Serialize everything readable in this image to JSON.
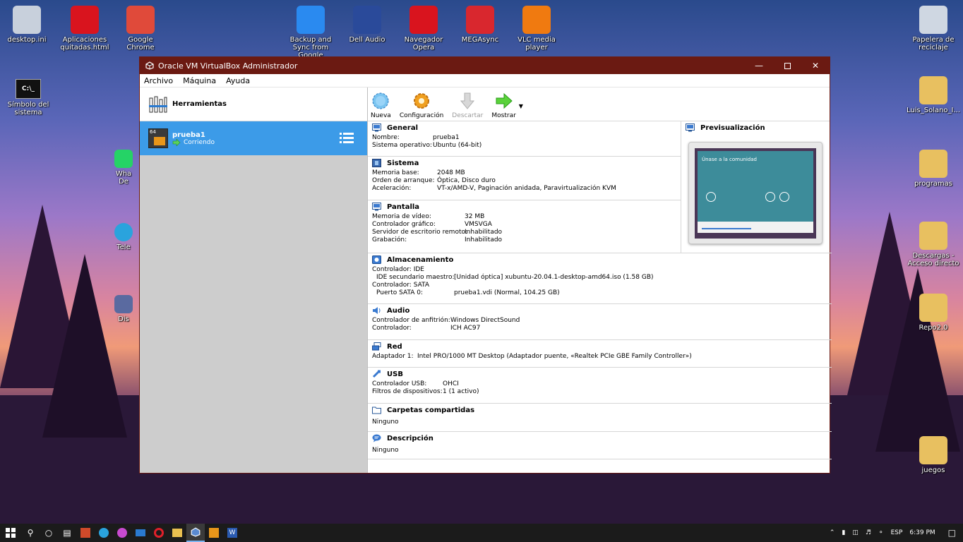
{
  "desktop": {
    "icons_left": [
      {
        "label": "desktop.ini",
        "icon": "ini-file-icon",
        "color": "#c8d0dc"
      },
      {
        "label": "Aplicaciones quitadas.html",
        "icon": "opera-icon",
        "color": "#d9141e"
      },
      {
        "label": "Google Chrome",
        "icon": "chrome-icon",
        "color": "#e04a3a"
      },
      {
        "label": "Backup and Sync from Google",
        "icon": "cloud-upload-icon",
        "color": "#2a8af0"
      },
      {
        "label": "Dell Audio",
        "icon": "audio-wave-icon",
        "color": "#2a4a9a"
      },
      {
        "label": "Navegador Opera",
        "icon": "opera-icon",
        "color": "#d9141e"
      },
      {
        "label": "MEGAsync",
        "icon": "mega-icon",
        "color": "#d9272e"
      },
      {
        "label": "VLC media player",
        "icon": "vlc-cone-icon",
        "color": "#f07a10"
      }
    ],
    "simbolo": "Símbolo del sistema",
    "partial": [
      "Wha",
      "De",
      "Tele",
      "Dis"
    ],
    "icons_right": [
      {
        "label": "Papelera de reciclaje",
        "icon": "recycle-bin-icon",
        "color": "#cfd7e2"
      },
      {
        "label": "Luis_Solano_I...",
        "icon": "folder-icon",
        "color": "#e8c060"
      },
      {
        "label": "programas",
        "icon": "folder-icon",
        "color": "#e8c060"
      },
      {
        "label": "Descargas - Acceso directo",
        "icon": "download-folder-icon",
        "color": "#e8c060"
      },
      {
        "label": "Repo2.0",
        "icon": "folder-icon",
        "color": "#e8c060"
      },
      {
        "label": "juegos",
        "icon": "games-folder-icon",
        "color": "#e8c060"
      }
    ]
  },
  "window": {
    "title": "Oracle VM VirtualBox Administrador",
    "menu": [
      "Archivo",
      "Máquina",
      "Ayuda"
    ],
    "tools_label": "Herramientas",
    "vm": {
      "name": "prueba1",
      "state": "Corriendo",
      "badge": "64"
    },
    "toolbar": [
      {
        "label": "Nueva",
        "icon": "new-vm-icon",
        "disabled": false
      },
      {
        "label": "Configuración",
        "icon": "settings-gear-icon",
        "disabled": false
      },
      {
        "label": "Descartar",
        "icon": "discard-arrow-icon",
        "disabled": true
      },
      {
        "label": "Mostrar",
        "icon": "show-arrow-icon",
        "disabled": false
      }
    ],
    "sections": {
      "general": {
        "title": "General",
        "rows": [
          [
            "Nombre:",
            "prueba1"
          ],
          [
            "Sistema operativo:",
            "Ubuntu (64-bit)"
          ]
        ]
      },
      "sistema": {
        "title": "Sistema",
        "rows": [
          [
            "Memoria base:",
            "2048 MB"
          ],
          [
            "Orden de arranque:",
            "Óptica, Disco duro"
          ],
          [
            "Aceleración:",
            "VT-x/AMD-V, Paginación anidada, Paravirtualización KVM"
          ]
        ]
      },
      "pantalla": {
        "title": "Pantalla",
        "rows": [
          [
            "Memoria de vídeo:",
            "32 MB"
          ],
          [
            "Controlador gráfico:",
            "VMSVGA"
          ],
          [
            "Servidor de escritorio remoto:",
            "Inhabilitado"
          ],
          [
            "Grabación:",
            "Inhabilitado"
          ]
        ]
      },
      "almacenamiento": {
        "title": "Almacenamiento",
        "lines": [
          "Controlador: IDE",
          "IDE secundario maestro:",
          "[Unidad óptica] xubuntu-20.04.1-desktop-amd64.iso (1.58 GB)",
          "Controlador: SATA",
          "Puerto SATA 0:",
          "prueba1.vdi (Normal, 104.25 GB)"
        ]
      },
      "audio": {
        "title": "Audio",
        "rows": [
          [
            "Controlador de anfitrión:",
            "Windows DirectSound"
          ],
          [
            "Controlador:",
            "ICH AC97"
          ]
        ]
      },
      "red": {
        "title": "Red",
        "rows": [
          [
            "Adaptador 1:",
            "Intel PRO/1000 MT Desktop (Adaptador puente, «Realtek PCIe GBE Family Controller»)"
          ]
        ]
      },
      "usb": {
        "title": "USB",
        "rows": [
          [
            "Controlador USB:",
            "OHCI"
          ],
          [
            "Filtros de dispositivos:",
            "1 (1 activo)"
          ]
        ]
      },
      "carpetas": {
        "title": "Carpetas compartidas",
        "value": "Ninguno"
      },
      "descripcion": {
        "title": "Descripción",
        "value": "Ninguno"
      }
    },
    "preview": {
      "title": "Previsualización",
      "screen_heading": "Únase a la comunidad"
    }
  },
  "taskbar": {
    "tray_lang": "ESP",
    "time": "6:39 PM"
  }
}
